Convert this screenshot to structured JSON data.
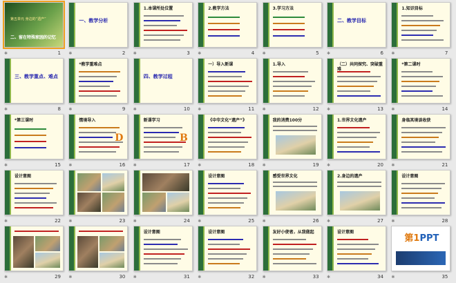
{
  "slides": [
    {
      "n": "1",
      "title": "",
      "kind": "cover",
      "cover_sub": "第五单元 身边的“遗产”",
      "cover_title": "二、留在特殊家园的记忆"
    },
    {
      "n": "2",
      "title": "一、教学分析",
      "kind": "title"
    },
    {
      "n": "3",
      "title": "1.本课所处位置",
      "kind": "text"
    },
    {
      "n": "4",
      "title": "2.教学方法",
      "kind": "list"
    },
    {
      "n": "5",
      "title": "3.学习方法",
      "kind": "list"
    },
    {
      "n": "6",
      "title": "二、教学目标",
      "kind": "title"
    },
    {
      "n": "7",
      "title": "1.知识目标",
      "kind": "text"
    },
    {
      "n": "8",
      "title": "三、教学重点、难点",
      "kind": "title"
    },
    {
      "n": "9",
      "title": "*教学重难点",
      "kind": "text"
    },
    {
      "n": "10",
      "title": "四、教学过程",
      "kind": "title"
    },
    {
      "n": "11",
      "title": "一）导入新课",
      "kind": "text"
    },
    {
      "n": "12",
      "title": "1.导入",
      "kind": "text"
    },
    {
      "n": "13",
      "title": "（二）共同探究、突破重难",
      "kind": "text"
    },
    {
      "n": "14",
      "title": "*第二课时",
      "kind": "text"
    },
    {
      "n": "15",
      "title": "*第三课时",
      "kind": "list"
    },
    {
      "n": "16",
      "title": "情境导入",
      "kind": "text",
      "letter": "D"
    },
    {
      "n": "17",
      "title": "新课学习",
      "kind": "text",
      "letter": "B"
    },
    {
      "n": "18",
      "title": "《中华文化“遗产”》",
      "kind": "text"
    },
    {
      "n": "19",
      "title": "我的消费100分",
      "kind": "photo"
    },
    {
      "n": "20",
      "title": "1.世界文化遗产",
      "kind": "text"
    },
    {
      "n": "21",
      "title": "身临其境谈收获",
      "kind": "text"
    },
    {
      "n": "22",
      "title": "设计意图",
      "kind": "text"
    },
    {
      "n": "23",
      "title": "",
      "kind": "photos"
    },
    {
      "n": "24",
      "title": "",
      "kind": "photos2"
    },
    {
      "n": "25",
      "title": "设计意图",
      "kind": "text"
    },
    {
      "n": "26",
      "title": "感受世界文化",
      "kind": "photo"
    },
    {
      "n": "27",
      "title": "2.身边的遗产",
      "kind": "photo"
    },
    {
      "n": "28",
      "title": "设计意图",
      "kind": "text"
    },
    {
      "n": "29",
      "title": "",
      "kind": "photos3"
    },
    {
      "n": "30",
      "title": "",
      "kind": "photos3"
    },
    {
      "n": "31",
      "title": "设计意图",
      "kind": "text"
    },
    {
      "n": "32",
      "title": "设计意图",
      "kind": "text"
    },
    {
      "n": "33",
      "title": "友好小使者，从我做起",
      "kind": "text"
    },
    {
      "n": "34",
      "title": "设计意图",
      "kind": "text"
    },
    {
      "n": "35",
      "title": "",
      "kind": "ppt",
      "logo_num": "第1",
      "logo_text": "PPT"
    }
  ]
}
